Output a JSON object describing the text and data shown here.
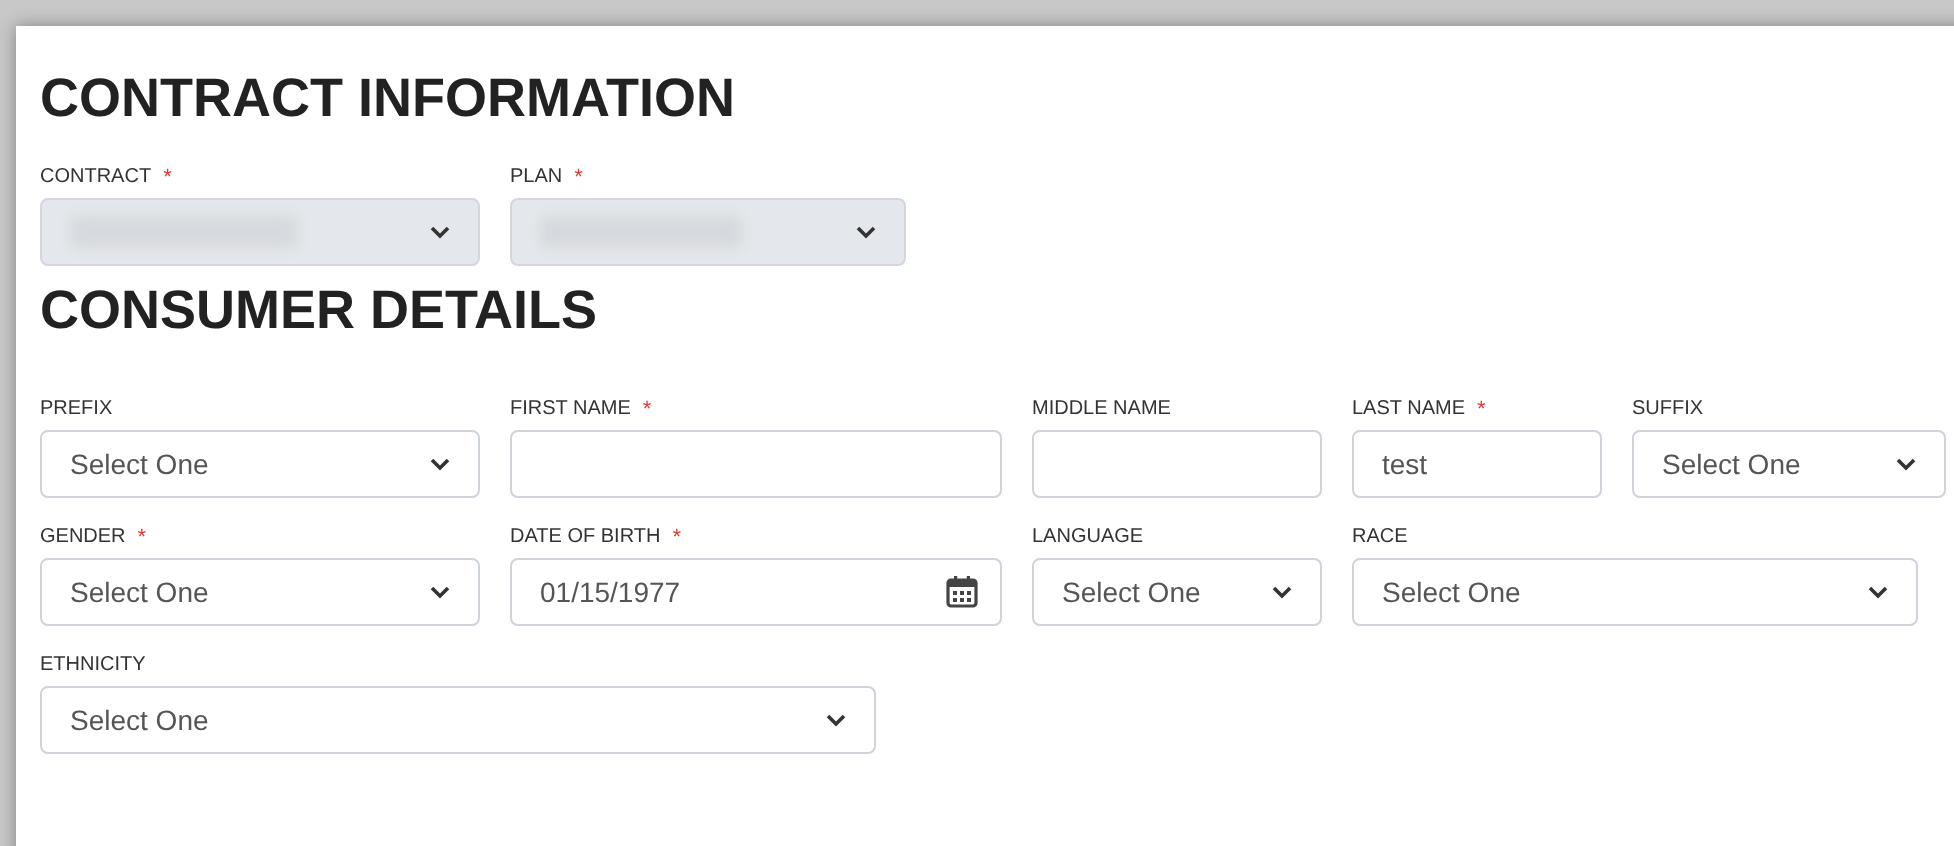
{
  "sections": [
    {
      "title": "CONTRACT INFORMATION",
      "rows": [
        [
          {
            "label": "CONTRACT",
            "required_mark": "*",
            "kind": "select",
            "disabled": true
          },
          {
            "label": "PLAN",
            "required_mark": "*",
            "kind": "select",
            "disabled": true
          }
        ]
      ]
    },
    {
      "title": "CONSUMER DETAILS",
      "rows": [
        [
          {
            "label": "PREFIX",
            "kind": "select",
            "disabled": false,
            "value": "Select One"
          },
          {
            "label": "FIRST NAME",
            "required_mark": "*",
            "kind": "text",
            "disabled": false
          },
          {
            "label": "MIDDLE NAME",
            "kind": "text",
            "disabled": false
          },
          {
            "label": "LAST NAME",
            "required_mark": "*",
            "kind": "text",
            "disabled": false,
            "value": "test"
          },
          {
            "label": "SUFFIX",
            "kind": "select",
            "disabled": false,
            "value": "Select One"
          }
        ],
        [
          {
            "label": "GENDER",
            "required_mark": "*",
            "kind": "select",
            "disabled": false,
            "value": "Select One"
          },
          {
            "label": "DATE OF BIRTH",
            "required_mark": "*",
            "kind": "date",
            "disabled": false,
            "value": "01/15/1977"
          },
          {
            "label": "LANGUAGE",
            "kind": "select",
            "disabled": false,
            "value": "Select One"
          },
          {
            "label": "RACE",
            "kind": "select",
            "disabled": false,
            "value": "Select One"
          }
        ],
        [
          {
            "label": "ETHNICITY",
            "kind": "select",
            "disabled": false,
            "value": "Select One"
          }
        ]
      ]
    }
  ]
}
